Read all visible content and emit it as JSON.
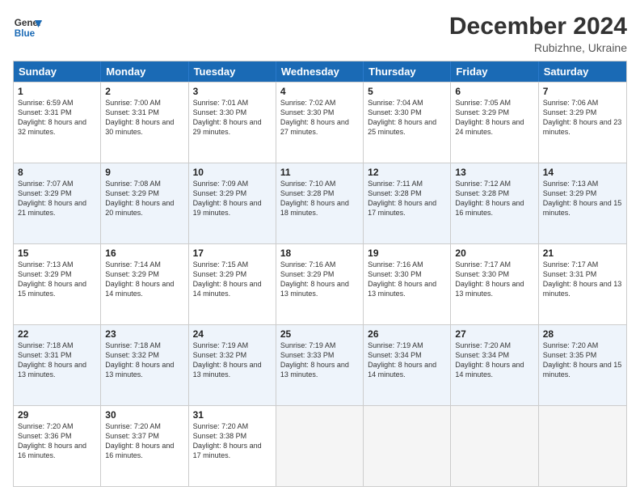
{
  "logo": {
    "line1": "General",
    "line2": "Blue"
  },
  "title": "December 2024",
  "subtitle": "Rubizhne, Ukraine",
  "header": {
    "days": [
      "Sunday",
      "Monday",
      "Tuesday",
      "Wednesday",
      "Thursday",
      "Friday",
      "Saturday"
    ]
  },
  "weeks": [
    [
      {
        "day": "1",
        "rise": "Sunrise: 6:59 AM",
        "set": "Sunset: 3:31 PM",
        "daylight": "Daylight: 8 hours and 32 minutes."
      },
      {
        "day": "2",
        "rise": "Sunrise: 7:00 AM",
        "set": "Sunset: 3:31 PM",
        "daylight": "Daylight: 8 hours and 30 minutes."
      },
      {
        "day": "3",
        "rise": "Sunrise: 7:01 AM",
        "set": "Sunset: 3:30 PM",
        "daylight": "Daylight: 8 hours and 29 minutes."
      },
      {
        "day": "4",
        "rise": "Sunrise: 7:02 AM",
        "set": "Sunset: 3:30 PM",
        "daylight": "Daylight: 8 hours and 27 minutes."
      },
      {
        "day": "5",
        "rise": "Sunrise: 7:04 AM",
        "set": "Sunset: 3:30 PM",
        "daylight": "Daylight: 8 hours and 25 minutes."
      },
      {
        "day": "6",
        "rise": "Sunrise: 7:05 AM",
        "set": "Sunset: 3:29 PM",
        "daylight": "Daylight: 8 hours and 24 minutes."
      },
      {
        "day": "7",
        "rise": "Sunrise: 7:06 AM",
        "set": "Sunset: 3:29 PM",
        "daylight": "Daylight: 8 hours and 23 minutes."
      }
    ],
    [
      {
        "day": "8",
        "rise": "Sunrise: 7:07 AM",
        "set": "Sunset: 3:29 PM",
        "daylight": "Daylight: 8 hours and 21 minutes."
      },
      {
        "day": "9",
        "rise": "Sunrise: 7:08 AM",
        "set": "Sunset: 3:29 PM",
        "daylight": "Daylight: 8 hours and 20 minutes."
      },
      {
        "day": "10",
        "rise": "Sunrise: 7:09 AM",
        "set": "Sunset: 3:29 PM",
        "daylight": "Daylight: 8 hours and 19 minutes."
      },
      {
        "day": "11",
        "rise": "Sunrise: 7:10 AM",
        "set": "Sunset: 3:28 PM",
        "daylight": "Daylight: 8 hours and 18 minutes."
      },
      {
        "day": "12",
        "rise": "Sunrise: 7:11 AM",
        "set": "Sunset: 3:28 PM",
        "daylight": "Daylight: 8 hours and 17 minutes."
      },
      {
        "day": "13",
        "rise": "Sunrise: 7:12 AM",
        "set": "Sunset: 3:28 PM",
        "daylight": "Daylight: 8 hours and 16 minutes."
      },
      {
        "day": "14",
        "rise": "Sunrise: 7:13 AM",
        "set": "Sunset: 3:29 PM",
        "daylight": "Daylight: 8 hours and 15 minutes."
      }
    ],
    [
      {
        "day": "15",
        "rise": "Sunrise: 7:13 AM",
        "set": "Sunset: 3:29 PM",
        "daylight": "Daylight: 8 hours and 15 minutes."
      },
      {
        "day": "16",
        "rise": "Sunrise: 7:14 AM",
        "set": "Sunset: 3:29 PM",
        "daylight": "Daylight: 8 hours and 14 minutes."
      },
      {
        "day": "17",
        "rise": "Sunrise: 7:15 AM",
        "set": "Sunset: 3:29 PM",
        "daylight": "Daylight: 8 hours and 14 minutes."
      },
      {
        "day": "18",
        "rise": "Sunrise: 7:16 AM",
        "set": "Sunset: 3:29 PM",
        "daylight": "Daylight: 8 hours and 13 minutes."
      },
      {
        "day": "19",
        "rise": "Sunrise: 7:16 AM",
        "set": "Sunset: 3:30 PM",
        "daylight": "Daylight: 8 hours and 13 minutes."
      },
      {
        "day": "20",
        "rise": "Sunrise: 7:17 AM",
        "set": "Sunset: 3:30 PM",
        "daylight": "Daylight: 8 hours and 13 minutes."
      },
      {
        "day": "21",
        "rise": "Sunrise: 7:17 AM",
        "set": "Sunset: 3:31 PM",
        "daylight": "Daylight: 8 hours and 13 minutes."
      }
    ],
    [
      {
        "day": "22",
        "rise": "Sunrise: 7:18 AM",
        "set": "Sunset: 3:31 PM",
        "daylight": "Daylight: 8 hours and 13 minutes."
      },
      {
        "day": "23",
        "rise": "Sunrise: 7:18 AM",
        "set": "Sunset: 3:32 PM",
        "daylight": "Daylight: 8 hours and 13 minutes."
      },
      {
        "day": "24",
        "rise": "Sunrise: 7:19 AM",
        "set": "Sunset: 3:32 PM",
        "daylight": "Daylight: 8 hours and 13 minutes."
      },
      {
        "day": "25",
        "rise": "Sunrise: 7:19 AM",
        "set": "Sunset: 3:33 PM",
        "daylight": "Daylight: 8 hours and 13 minutes."
      },
      {
        "day": "26",
        "rise": "Sunrise: 7:19 AM",
        "set": "Sunset: 3:34 PM",
        "daylight": "Daylight: 8 hours and 14 minutes."
      },
      {
        "day": "27",
        "rise": "Sunrise: 7:20 AM",
        "set": "Sunset: 3:34 PM",
        "daylight": "Daylight: 8 hours and 14 minutes."
      },
      {
        "day": "28",
        "rise": "Sunrise: 7:20 AM",
        "set": "Sunset: 3:35 PM",
        "daylight": "Daylight: 8 hours and 15 minutes."
      }
    ],
    [
      {
        "day": "29",
        "rise": "Sunrise: 7:20 AM",
        "set": "Sunset: 3:36 PM",
        "daylight": "Daylight: 8 hours and 16 minutes."
      },
      {
        "day": "30",
        "rise": "Sunrise: 7:20 AM",
        "set": "Sunset: 3:37 PM",
        "daylight": "Daylight: 8 hours and 16 minutes."
      },
      {
        "day": "31",
        "rise": "Sunrise: 7:20 AM",
        "set": "Sunset: 3:38 PM",
        "daylight": "Daylight: 8 hours and 17 minutes."
      },
      null,
      null,
      null,
      null
    ]
  ]
}
